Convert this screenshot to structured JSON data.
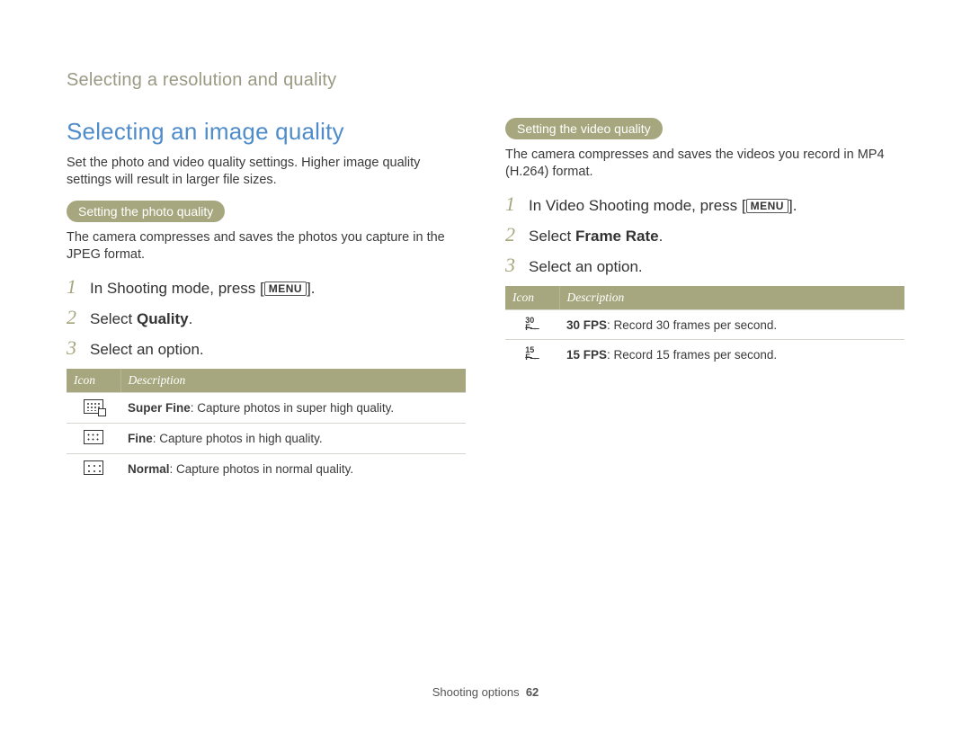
{
  "breadcrumb": "Selecting a resolution and quality",
  "section_title": "Selecting an image quality",
  "intro": "Set the photo and video quality settings. Higher image quality settings will result in larger file sizes.",
  "photo": {
    "pill": "Setting the photo quality",
    "para": "The camera compresses and saves the photos you capture in the JPEG format.",
    "steps": {
      "s1_pre": "In Shooting mode, press [",
      "s1_menu": "MENU",
      "s1_post": "].",
      "s2_pre": "Select ",
      "s2_bold": "Quality",
      "s2_post": ".",
      "s3": "Select an option."
    },
    "table": {
      "h_icon": "Icon",
      "h_desc": "Description",
      "rows": [
        {
          "bold": "Super Fine",
          "rest": ": Capture photos in super high quality."
        },
        {
          "bold": "Fine",
          "rest": ": Capture photos in high quality."
        },
        {
          "bold": "Normal",
          "rest": ": Capture photos in normal quality."
        }
      ]
    }
  },
  "video": {
    "pill": "Setting the video quality",
    "para": "The camera compresses and saves the videos you record in MP4 (H.264) format.",
    "steps": {
      "s1_pre": "In Video Shooting mode, press [",
      "s1_menu": "MENU",
      "s1_post": "].",
      "s2_pre": "Select ",
      "s2_bold": "Frame Rate",
      "s2_post": ".",
      "s3": "Select an option."
    },
    "table": {
      "h_icon": "Icon",
      "h_desc": "Description",
      "rows": [
        {
          "fps": "30",
          "bold": "30 FPS",
          "rest": ": Record 30 frames per second."
        },
        {
          "fps": "15",
          "bold": "15 FPS",
          "rest": ": Record 15 frames per second."
        }
      ]
    }
  },
  "footer": {
    "label": "Shooting options",
    "page": "62"
  }
}
